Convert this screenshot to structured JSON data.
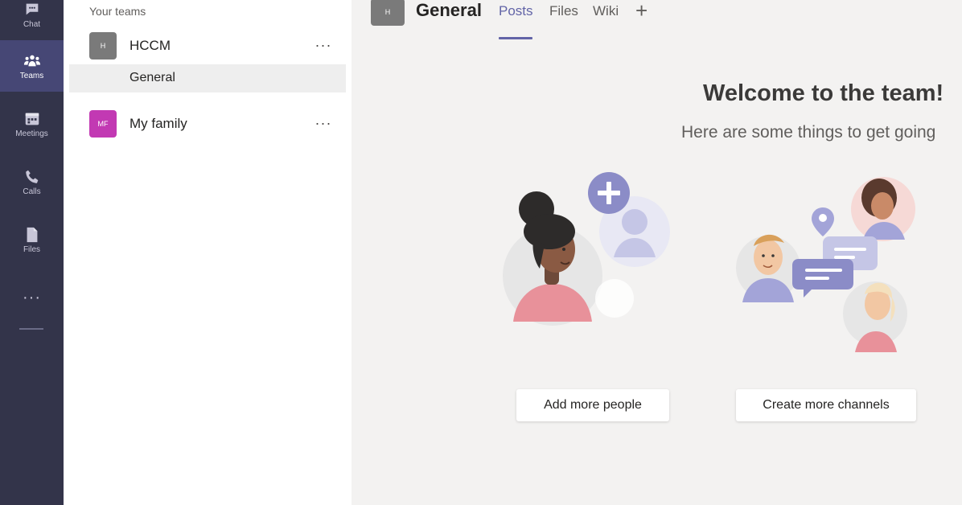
{
  "rail": {
    "items": [
      {
        "label": "Chat",
        "icon": "chat-icon"
      },
      {
        "label": "Teams",
        "icon": "teams-icon",
        "active": true
      },
      {
        "label": "Meetings",
        "icon": "calendar-icon"
      },
      {
        "label": "Calls",
        "icon": "phone-icon"
      },
      {
        "label": "Files",
        "icon": "file-icon"
      }
    ],
    "more": "···"
  },
  "teams_pane": {
    "section_title": "Your teams",
    "teams": [
      {
        "name": "HCCM",
        "initials": "H",
        "color": "#7a7a7a",
        "more": "···",
        "channels": [
          {
            "name": "General",
            "selected": true
          }
        ]
      },
      {
        "name": "My family",
        "initials": "MF",
        "color": "#c239b3",
        "more": "···"
      }
    ]
  },
  "main": {
    "channel_initials": "H",
    "channel_title": "General",
    "tabs": [
      {
        "label": "Posts",
        "active": true
      },
      {
        "label": "Files"
      },
      {
        "label": "Wiki"
      }
    ],
    "add_tab": "+",
    "welcome_title": "Welcome to the team!",
    "welcome_subtitle": "Here are some things to get going",
    "actions": [
      {
        "label": "Add more people"
      },
      {
        "label": "Create more channels"
      }
    ]
  },
  "colors": {
    "accent": "#6264a7",
    "rail": "#33344a",
    "rail_active": "#464775"
  }
}
